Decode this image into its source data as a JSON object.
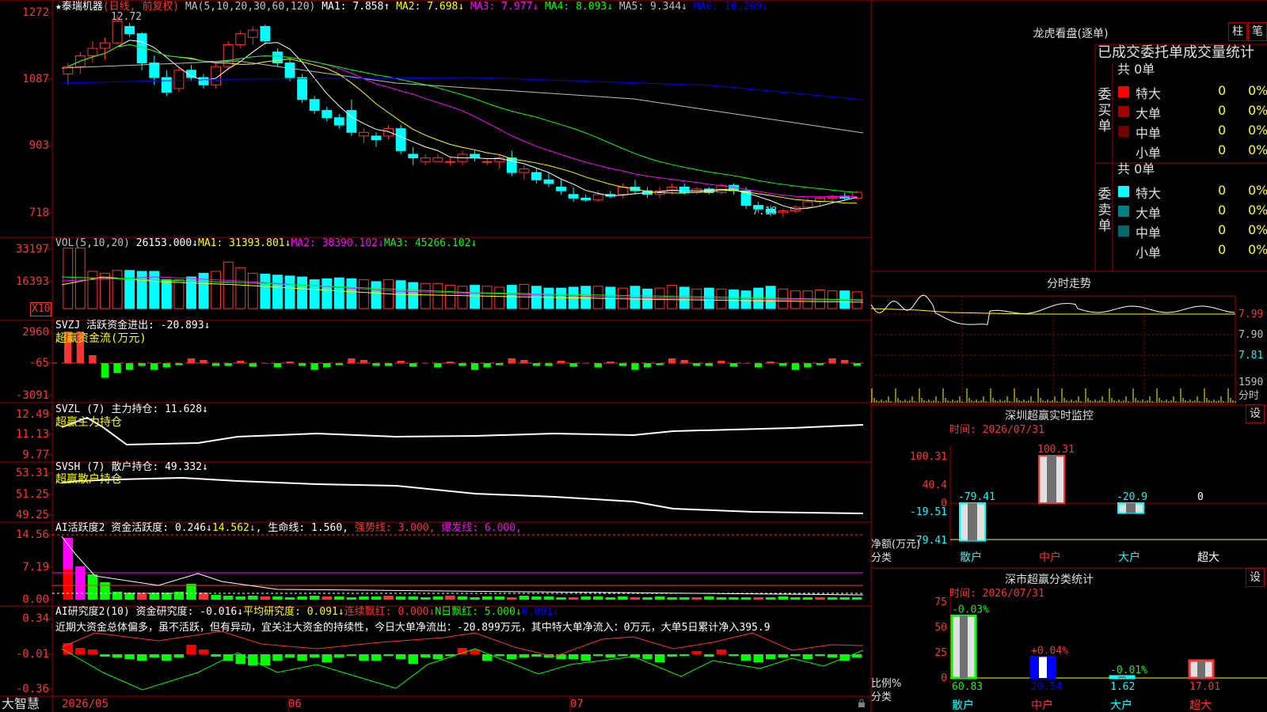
{
  "header": {
    "star": "★",
    "stock_name": "泰瑞机器",
    "period": "(日线, 前复权)",
    "ma_def": "MA(5,10,20,30,60,120)",
    "ma1": "MA1: 7.858↑",
    "ma2": "MA2: 7.698↓",
    "ma3": "MA3: 7.977↓",
    "ma4": "MA4: 8.093↓",
    "ma5": "MA5: 9.344↓",
    "ma6": "MA6: 10.269↓",
    "high_mark": "12.72",
    "low_mark": "7.18"
  },
  "price_axis": [
    "1272",
    "1087",
    "903",
    "718"
  ],
  "vol": {
    "label": "VOL(5,10,20)",
    "value": "26153.000↓",
    "ma1": "MA1: 31393.801↓",
    "ma2": "MA2: 38390.102↓",
    "ma3": "MA3: 45266.102↓",
    "axis": [
      "33197",
      "16393"
    ],
    "unit": "X10"
  },
  "svzj": {
    "label": "SVZJ  活跃资金进出: -20.893↓",
    "sub": "超赢资金流(万元)",
    "axis": [
      "2960",
      "-65",
      "-3091"
    ]
  },
  "svzl": {
    "label": "SVZL (7) 主力持仓: 11.628↓",
    "sub": "超赢主力持仓",
    "axis": [
      "12.49",
      "11.13",
      "9.77"
    ]
  },
  "svsh": {
    "label": "SVSH (7) 散户持仓: 49.332↓",
    "sub": "超赢散户持仓",
    "axis": [
      "53.31",
      "51.25",
      "49.25"
    ]
  },
  "ai1": {
    "label": "AI活跃度2 资金活跃度: 0.246↓",
    "v2": "14.562",
    "life": "生命线: 1.560",
    "strong": "强势线: 3.000",
    "burst": "爆发线: 6.000",
    "axis": [
      "14.56",
      "7.19",
      "0.00"
    ]
  },
  "ai2": {
    "label": "AI研究度2(10) 资金研究度: -0.016↓",
    "avg": "平均研究度: 0.091↓",
    "streak": "连续飘红: 0.000↓",
    "nday": "N日飘红: 5.000↓",
    "last": "0.091↓",
    "axis": [
      "0.34",
      "-0.01",
      "-0.36"
    ]
  },
  "commentary": "近期大资金总体偏多，虽不活跃，但有异动，宜关注大资金的持续性，今日大单净流出：-20.899万元，其中特大单净流入：0万元，大单5日累计净入395.9",
  "bottom": {
    "logo": "大智慧",
    "dates": [
      "2026/05",
      "06",
      "07"
    ]
  },
  "lhb": {
    "title": "龙虎看盘(逐单)",
    "btn_bar": "柱",
    "btn_stroke": "笔",
    "tabs": "已成交委托单成交量统计",
    "buy_side": "委买单",
    "sell_side": "委卖单",
    "buy_total": "共 0单",
    "sell_total": "共 0单",
    "buy_rows": [
      {
        "label": "特大",
        "value": "0",
        "pct": "0%",
        "color": "#ff0000"
      },
      {
        "label": "大单",
        "value": "0",
        "pct": "0%",
        "color": "#a00000"
      },
      {
        "label": "中单",
        "value": "0",
        "pct": "0%",
        "color": "#700000"
      },
      {
        "label": "小单",
        "value": "0",
        "pct": "0%",
        "color": "#000000"
      }
    ],
    "sell_rows": [
      {
        "label": "特大",
        "value": "0",
        "pct": "0%",
        "color": "#00ffff"
      },
      {
        "label": "大单",
        "value": "0",
        "pct": "0%",
        "color": "#008080"
      },
      {
        "label": "中单",
        "value": "0",
        "pct": "0%",
        "color": "#006a6a"
      },
      {
        "label": "小单",
        "value": "0",
        "pct": "0%",
        "color": "#000000"
      }
    ]
  },
  "intraday": {
    "title": "分时走势",
    "axis": [
      "7.99",
      "7.90",
      "7.81"
    ],
    "vol_axis": "1590",
    "vol_label": "分时"
  },
  "sz_monitor": {
    "title": "深圳超赢实时监控",
    "btn": "设",
    "time": "时间: 2026/07/31",
    "axis": [
      "100.31",
      "40.4",
      "0",
      "-19.51",
      "-79.41"
    ],
    "y_title": "净额(万元)",
    "x_title": "分类",
    "categories": [
      "散户",
      "中户",
      "大户",
      "超大"
    ],
    "values": [
      -79.41,
      100.31,
      -20.9,
      0
    ],
    "value_labels": [
      "-79.41",
      "100.31",
      "-20.9",
      "0"
    ]
  },
  "sz_class": {
    "title": "深市超赢分类统计",
    "btn": "设",
    "time": "时间: 2026/07/31",
    "axis": [
      "75",
      "50",
      "25",
      "0"
    ],
    "y_title": "比例%",
    "x_title": "分类",
    "categories": [
      "散户",
      "中户",
      "大户",
      "超大"
    ],
    "values": [
      60.83,
      20.54,
      1.62,
      17.01
    ],
    "value_labels": [
      "60.83",
      "20.54",
      "1.62",
      "17.01"
    ],
    "changes": [
      "-0.03%",
      "+0.04%",
      "-0.01%",
      ""
    ]
  },
  "colors": {
    "up": "#ff3232",
    "down": "#00ffff",
    "grid": "#a00000",
    "ma1": "#ffffff",
    "ma2": "#ffff00",
    "ma3": "#ff00ff",
    "ma4": "#00ff00",
    "ma5": "#c0c0c0",
    "ma6": "#0000ff"
  },
  "chart_data": {
    "type": "candlestick",
    "dates_range": [
      "2026/05",
      "2026/07"
    ],
    "ohlc": [
      [
        11.1,
        11.4,
        10.8,
        11.3
      ],
      [
        11.3,
        11.7,
        11.1,
        11.6
      ],
      [
        11.6,
        12.0,
        11.4,
        11.8
      ],
      [
        11.8,
        12.1,
        11.5,
        11.95
      ],
      [
        11.95,
        12.72,
        11.9,
        12.55
      ],
      [
        12.4,
        12.5,
        12.1,
        12.2
      ],
      [
        12.2,
        12.25,
        11.2,
        11.4
      ],
      [
        11.4,
        11.6,
        10.8,
        11.0
      ],
      [
        11.0,
        11.2,
        10.5,
        10.6
      ],
      [
        10.7,
        11.3,
        10.6,
        11.2
      ],
      [
        11.2,
        11.35,
        10.9,
        11.0
      ],
      [
        11.0,
        11.1,
        10.7,
        10.8
      ],
      [
        10.8,
        11.4,
        10.7,
        11.3
      ],
      [
        11.3,
        12.0,
        11.2,
        11.9
      ],
      [
        11.9,
        12.3,
        11.8,
        12.2
      ],
      [
        12.1,
        12.4,
        11.9,
        12.3
      ],
      [
        12.4,
        12.45,
        11.9,
        12.0
      ],
      [
        11.7,
        11.8,
        11.3,
        11.4
      ],
      [
        11.4,
        11.5,
        10.9,
        11.0
      ],
      [
        11.0,
        11.1,
        10.3,
        10.4
      ],
      [
        10.4,
        10.5,
        10.0,
        10.1
      ],
      [
        10.1,
        10.2,
        9.8,
        9.9
      ],
      [
        9.9,
        10.0,
        9.6,
        9.7
      ],
      [
        10.1,
        10.4,
        9.4,
        9.5
      ],
      [
        9.4,
        9.6,
        9.2,
        9.5
      ],
      [
        9.4,
        9.5,
        9.1,
        9.3
      ],
      [
        9.4,
        9.7,
        9.3,
        9.6
      ],
      [
        9.6,
        9.7,
        8.9,
        9.0
      ],
      [
        8.9,
        9.1,
        8.6,
        8.8
      ],
      [
        8.7,
        8.9,
        8.6,
        8.8
      ],
      [
        8.7,
        8.9,
        8.7,
        8.8
      ],
      [
        8.7,
        8.8,
        8.6,
        8.7
      ],
      [
        8.7,
        9.0,
        8.6,
        8.9
      ],
      [
        8.9,
        9.0,
        8.7,
        8.8
      ],
      [
        8.7,
        8.8,
        8.6,
        8.7
      ],
      [
        8.7,
        8.9,
        8.5,
        8.8
      ],
      [
        8.8,
        9.0,
        8.3,
        8.4
      ],
      [
        8.4,
        8.6,
        8.2,
        8.5
      ],
      [
        8.4,
        8.5,
        8.1,
        8.2
      ],
      [
        8.2,
        8.4,
        8.0,
        8.1
      ],
      [
        8.0,
        8.2,
        7.8,
        7.9
      ],
      [
        7.8,
        8.0,
        7.6,
        7.7
      ],
      [
        7.7,
        7.8,
        7.6,
        7.65
      ],
      [
        7.65,
        7.9,
        7.6,
        7.8
      ],
      [
        7.8,
        7.9,
        7.7,
        7.75
      ],
      [
        7.8,
        8.1,
        7.7,
        8.0
      ],
      [
        8.0,
        8.2,
        7.8,
        7.9
      ],
      [
        7.9,
        8.0,
        7.7,
        7.8
      ],
      [
        7.8,
        8.0,
        7.7,
        7.9
      ],
      [
        7.9,
        8.1,
        7.8,
        8.0
      ],
      [
        8.0,
        8.1,
        7.8,
        7.85
      ],
      [
        7.85,
        8.0,
        7.8,
        7.95
      ],
      [
        7.95,
        8.0,
        7.8,
        7.85
      ],
      [
        7.85,
        8.1,
        7.8,
        8.05
      ],
      [
        8.05,
        8.1,
        7.8,
        7.9
      ],
      [
        7.9,
        8.0,
        7.4,
        7.5
      ],
      [
        7.5,
        7.6,
        7.3,
        7.4
      ],
      [
        7.4,
        7.5,
        7.2,
        7.3
      ],
      [
        7.3,
        7.4,
        7.18,
        7.35
      ],
      [
        7.35,
        7.5,
        7.3,
        7.45
      ],
      [
        7.45,
        7.7,
        7.4,
        7.6
      ],
      [
        7.6,
        7.75,
        7.5,
        7.7
      ],
      [
        7.7,
        7.8,
        7.6,
        7.75
      ],
      [
        7.75,
        7.85,
        7.65,
        7.7
      ],
      [
        7.7,
        7.9,
        7.65,
        7.86
      ]
    ],
    "volume": [
      32500,
      32500,
      20000,
      19000,
      20500,
      20500,
      20000,
      20000,
      15500,
      15500,
      17000,
      19000,
      20000,
      25000,
      22000,
      19000,
      18500,
      18000,
      17500,
      17000,
      15500,
      16000,
      16500,
      16000,
      15500,
      14500,
      15500,
      15000,
      14000,
      13500,
      13500,
      12500,
      12000,
      12500,
      12000,
      11500,
      12500,
      13000,
      12000,
      11000,
      11000,
      11500,
      12000,
      12000,
      11500,
      11000,
      12000,
      10500,
      11000,
      12500,
      11500,
      10500,
      11000,
      10500,
      10000,
      9500,
      11000,
      12000,
      10500,
      9500,
      9500,
      10000,
      9500,
      9500,
      9000,
      9500
    ],
    "price_range": [
      7.18,
      12.72
    ]
  }
}
